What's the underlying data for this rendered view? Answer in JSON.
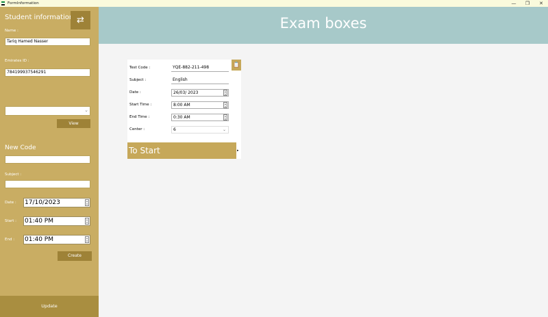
{
  "window": {
    "title": "FormInformation",
    "minimize": "—",
    "maximize": "❐",
    "close": "✕"
  },
  "colors": {
    "sidebar": "#c9ad63",
    "sidebar_dark": "#9e8237",
    "header": "#a7c9c9",
    "content": "#f4f4f4"
  },
  "sidebar": {
    "title": "Student information",
    "swap_icon": "⇄",
    "name_label": "Name :",
    "name_value": "Tariq Hamed Nasser",
    "emirates_label": "Emirates ID :",
    "emirates_value": "784199937546291",
    "combo_value": "",
    "combo_chevron": "⌄",
    "view_label": "View",
    "new_code_title": "New Code",
    "new_code_value": "",
    "subject_label": "Subject :",
    "subject_value": "",
    "date_label": "Date :",
    "date_value": "17/10/2023",
    "start_label": "Start :",
    "start_value": "01:40 PM",
    "end_label": "End :",
    "end_value": "01:40 PM",
    "create_label": "Create",
    "update_label": "Update"
  },
  "header": {
    "title": "Exam boxes"
  },
  "exam_card": {
    "clipboard_icon": "📋",
    "test_code_label": "Test Code :",
    "test_code_value": "YQE-882-211-498",
    "subject_label": "Subject :",
    "subject_value": "English",
    "date_label": "Date :",
    "date_value": "26/03/ 2023",
    "start_time_label": "Start Time :",
    "start_time_value": "8:00 AM",
    "end_time_label": "End Time :",
    "end_time_value": "0:30 AM",
    "center_label": "Center :",
    "center_value": "6",
    "to_start_label": "To Start",
    "arrow": "▸"
  }
}
